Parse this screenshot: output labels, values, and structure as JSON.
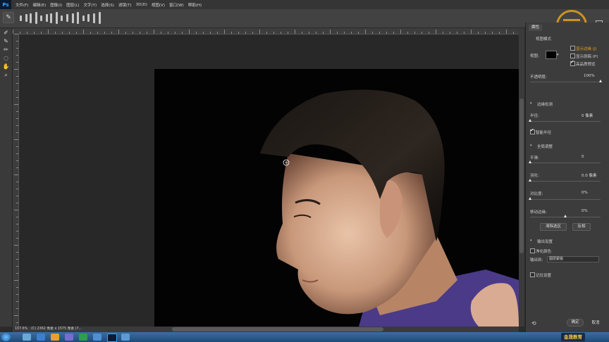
{
  "app": {
    "logo": "Ps",
    "menu": [
      "文件(F)",
      "编辑(E)",
      "图像(I)",
      "图层(L)",
      "文字(Y)",
      "选择(S)",
      "滤镜(T)",
      "3D(D)",
      "视图(V)",
      "窗口(W)",
      "帮助(H)"
    ]
  },
  "optionsbar": {
    "preset_icon": "refine-radius-brush-icon"
  },
  "tools": [
    "quick-selection-icon",
    "refine-radius-icon",
    "erase-refinements-icon",
    "lasso-icon",
    "hand-icon",
    "zoom-icon"
  ],
  "status": {
    "zoom": "107.6%",
    "doc": "(C) 2362 像素 x 1575 像素 (7..."
  },
  "properties": {
    "tab": "属性",
    "view_mode": {
      "heading": "视图模式",
      "view_label": "视图:",
      "show_edge": "显示边缘 (J)",
      "show_original": "显示原稿 (P)",
      "high_quality": "高品质预览",
      "show_edge_on": false,
      "show_original_on": false,
      "high_quality_on": true
    },
    "opacity": {
      "label": "不透明度:",
      "value": "100%",
      "level": 1.0
    },
    "edge_detection": {
      "heading": "边缘检测",
      "radius_label": "半径:",
      "radius_value": "0 像素",
      "radius_level": 0.0,
      "smart_radius": "智能半径",
      "smart_radius_on": true
    },
    "global_refinements": {
      "heading": "全局调整",
      "smooth_label": "平滑:",
      "smooth_value": "0",
      "smooth_level": 0.0,
      "feather_label": "羽化:",
      "feather_value": "0.0 像素",
      "feather_level": 0.0,
      "contrast_label": "对比度:",
      "contrast_value": "0%",
      "contrast_level": 0.0,
      "shift_edge_label": "移动边缘:",
      "shift_edge_value": "0%",
      "shift_edge_level": 0.5,
      "clear_selection": "清除选区",
      "invert": "反相"
    },
    "output": {
      "heading": "输出设置",
      "decontaminate": "净化颜色",
      "decontaminate_on": false,
      "output_to_label": "输出到:",
      "output_to_value": "图层蒙版",
      "remember": "记住设置",
      "remember_on": false
    },
    "ok": "确定",
    "cancel": "取消"
  },
  "colors": {
    "accent": "#31a8ff",
    "logo_gold": "#e3a21f",
    "panel": "#3c3c3c"
  },
  "taskbar": {
    "brand": "金晟教育"
  }
}
